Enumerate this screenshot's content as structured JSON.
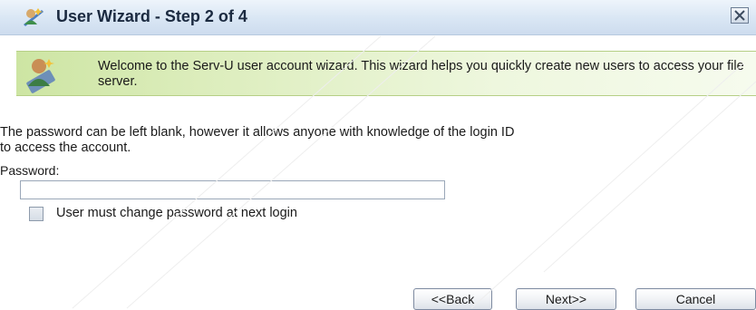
{
  "window": {
    "title": "User Wizard - Step 2 of 4"
  },
  "welcome": {
    "text": "Welcome to the Serv-U user account wizard. This wizard helps you quickly create new users to access your file server."
  },
  "form": {
    "info": "The password can be left blank, however it allows anyone with knowledge of the login ID\nto access the account.",
    "password_label": "Password:",
    "password_value": "",
    "change_password_label": "User must change password at next login",
    "change_password_checked": false
  },
  "buttons": {
    "back": "<<Back",
    "next": "Next>>",
    "cancel": "Cancel"
  },
  "icons": {
    "title": "user-wizard-icon",
    "welcome": "user-wizard-icon",
    "close": "close-icon"
  },
  "colors": {
    "titlebar": "#d9e6f4",
    "welcome_panel": "#dcedbc"
  }
}
